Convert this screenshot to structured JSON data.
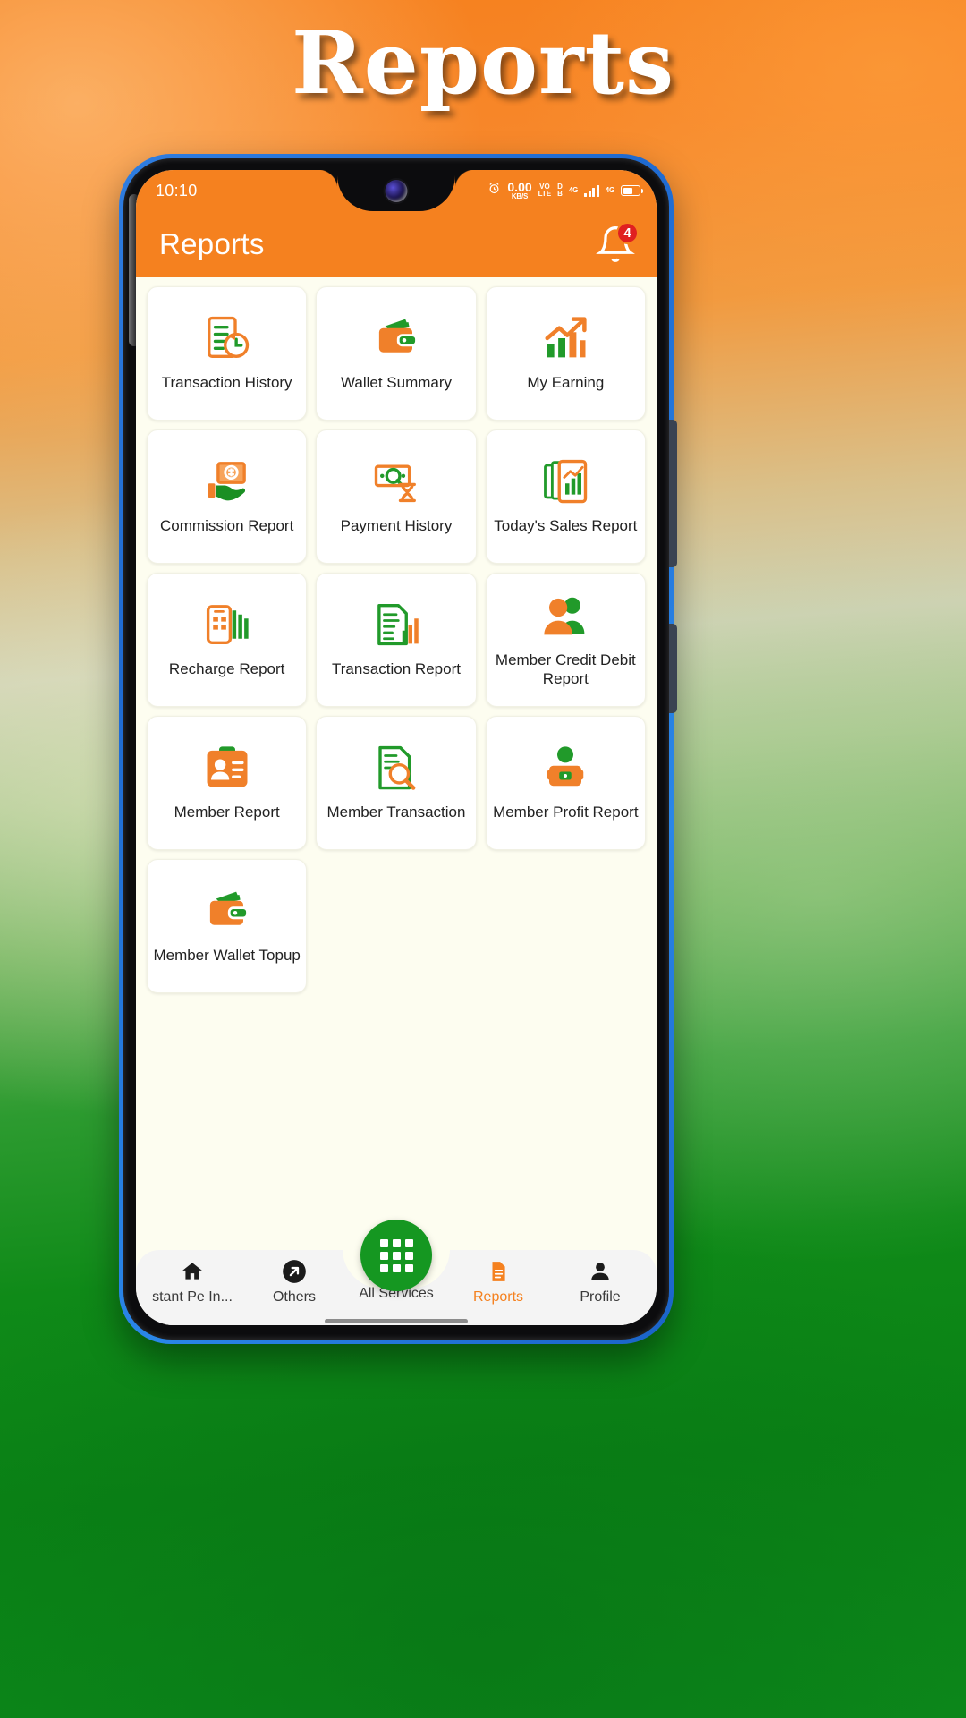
{
  "page": {
    "heading": "Reports",
    "accent_orange": "#f5811f",
    "accent_green": "#159721",
    "badge_red": "#e02020",
    "screen_bg": "#fdfdf0"
  },
  "status_bar": {
    "time": "10:10",
    "alarm_icon": "alarm-clock-icon",
    "net_speed_value": "0.00",
    "net_speed_unit": "KB/S",
    "volte_line1": "VO",
    "volte_line2": "LTE",
    "sim_line1": "D",
    "sim_line2": "B",
    "network_type": "4G",
    "signal_icon": "signal-bars-icon",
    "data_label": "4G",
    "battery_icon": "battery-icon"
  },
  "app_bar": {
    "title": "Reports",
    "bell_icon": "notification-bell-icon",
    "notification_count": "4"
  },
  "grid": {
    "tiles": [
      {
        "label": "Transaction History",
        "icon": "transaction-history-icon"
      },
      {
        "label": "Wallet Summary",
        "icon": "wallet-icon"
      },
      {
        "label": "My Earning",
        "icon": "growth-chart-icon"
      },
      {
        "label": "Commission Report",
        "icon": "hand-coin-icon"
      },
      {
        "label": "Payment History",
        "icon": "banknote-hourglass-icon"
      },
      {
        "label": "Today's Sales Report",
        "icon": "sales-report-icon"
      },
      {
        "label": "Recharge Report",
        "icon": "mobile-recharge-icon"
      },
      {
        "label": "Transaction Report",
        "icon": "document-chart-icon"
      },
      {
        "label": "Member Credit Debit Report",
        "icon": "members-icon"
      },
      {
        "label": "Member Report",
        "icon": "id-card-icon"
      },
      {
        "label": "Member Transaction",
        "icon": "document-search-icon"
      },
      {
        "label": "Member Profit Report",
        "icon": "member-profit-icon"
      },
      {
        "label": "Member Wallet Topup",
        "icon": "wallet-topup-icon"
      }
    ]
  },
  "bottom_nav": {
    "items": [
      {
        "label": "stant Pe In...",
        "icon": "home-icon",
        "active": false
      },
      {
        "label": "Others",
        "icon": "arrow-up-right-circle-icon",
        "active": false
      },
      {
        "label": "All Services",
        "icon": "grid-apps-icon",
        "active": false
      },
      {
        "label": "Reports",
        "icon": "report-document-icon",
        "active": true
      },
      {
        "label": "Profile",
        "icon": "person-icon",
        "active": false
      }
    ]
  }
}
